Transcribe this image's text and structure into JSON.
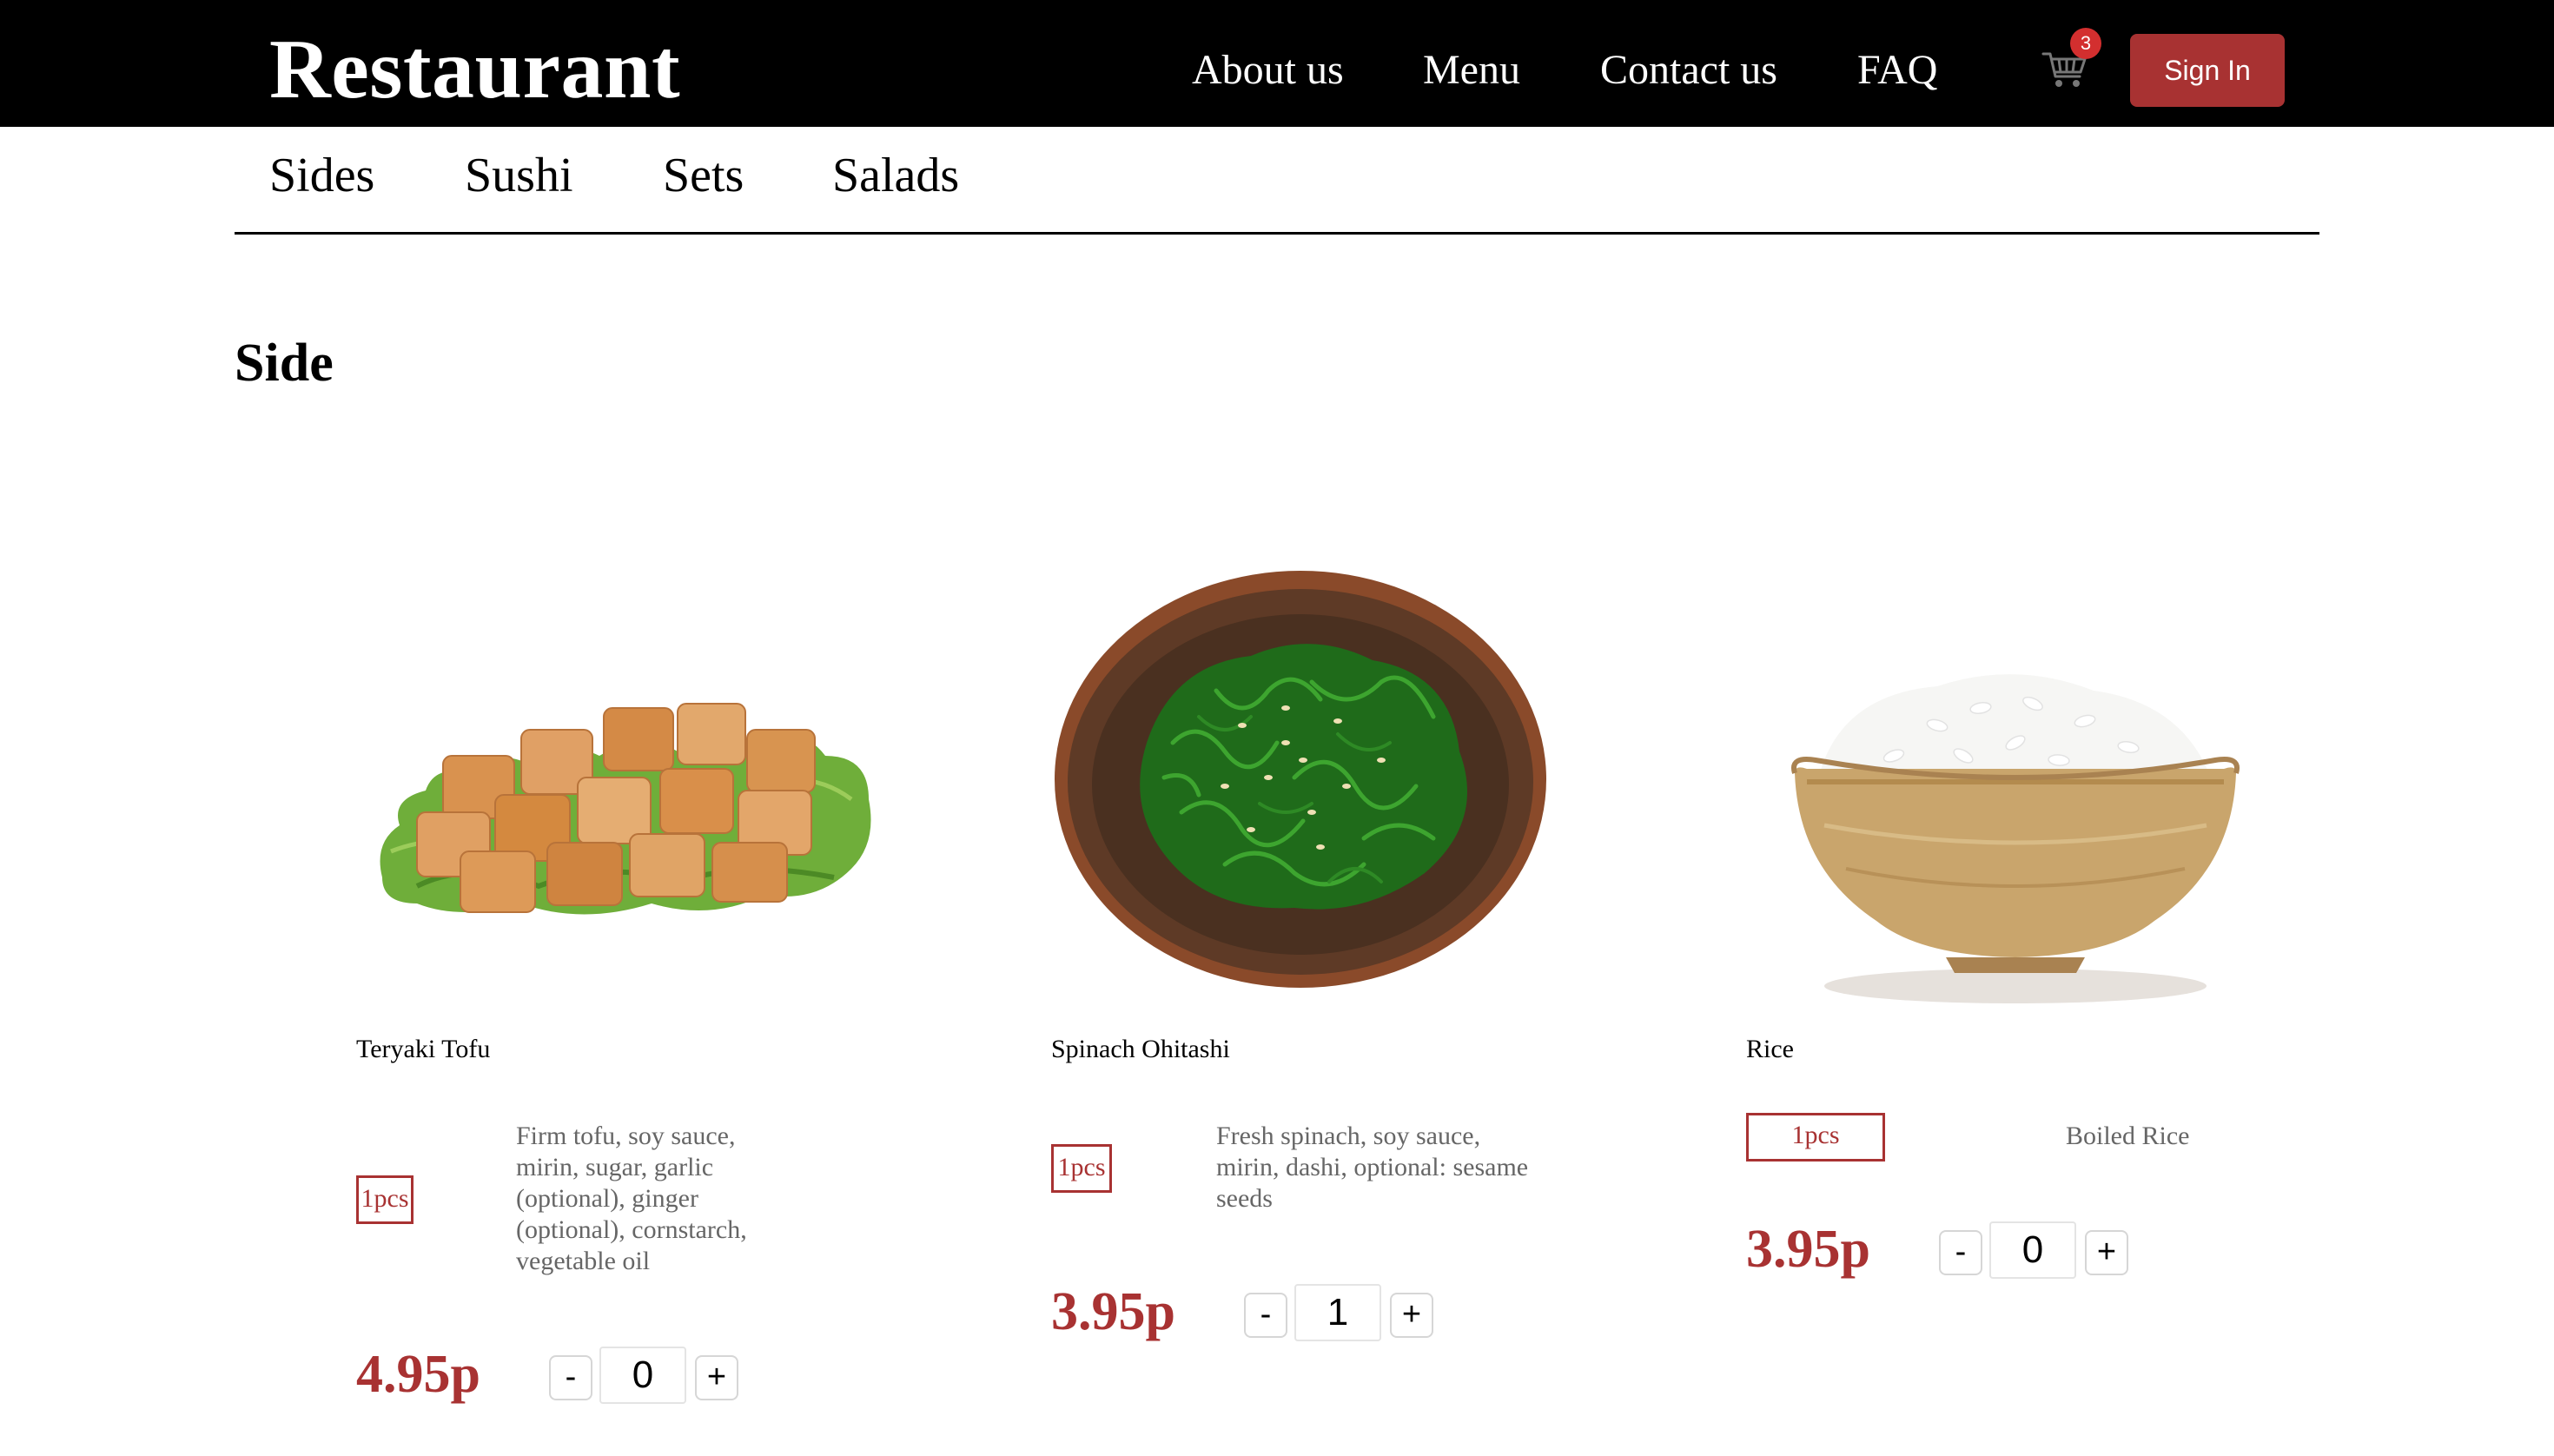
{
  "header": {
    "brand": "Restaurant",
    "nav": [
      "About us",
      "Menu",
      "Contact us",
      "FAQ"
    ],
    "cart_count": "3",
    "cart_icon": "cart-icon",
    "sign_in_label": "Sign In",
    "colors": {
      "bar": "#000000",
      "accent": "#a83232",
      "badge": "#d32f2f"
    }
  },
  "categories": [
    "Sides",
    "Sushi",
    "Sets",
    "Salads"
  ],
  "section": {
    "title": "Side"
  },
  "products": [
    {
      "name": "Teryaki Tofu",
      "unit": "1pcs",
      "description": "Firm tofu, soy sauce, mirin, sugar, garlic (optional), ginger (optional), cornstarch, vegetable oil",
      "price": "4.95p",
      "quantity": "0",
      "decrement_label": "-",
      "increment_label": "+",
      "image": "teryaki-tofu-image"
    },
    {
      "name": "Spinach Ohitashi",
      "unit": "1pcs",
      "description": "Fresh spinach, soy sauce, mirin, dashi, optional: sesame seeds",
      "price": "3.95p",
      "quantity": "1",
      "decrement_label": "-",
      "increment_label": "+",
      "image": "spinach-ohitashi-image"
    },
    {
      "name": "Rice",
      "unit": "1pcs",
      "description": "Boiled Rice",
      "price": "3.95p",
      "quantity": "0",
      "decrement_label": "-",
      "increment_label": "+",
      "image": "rice-bowl-image"
    }
  ]
}
